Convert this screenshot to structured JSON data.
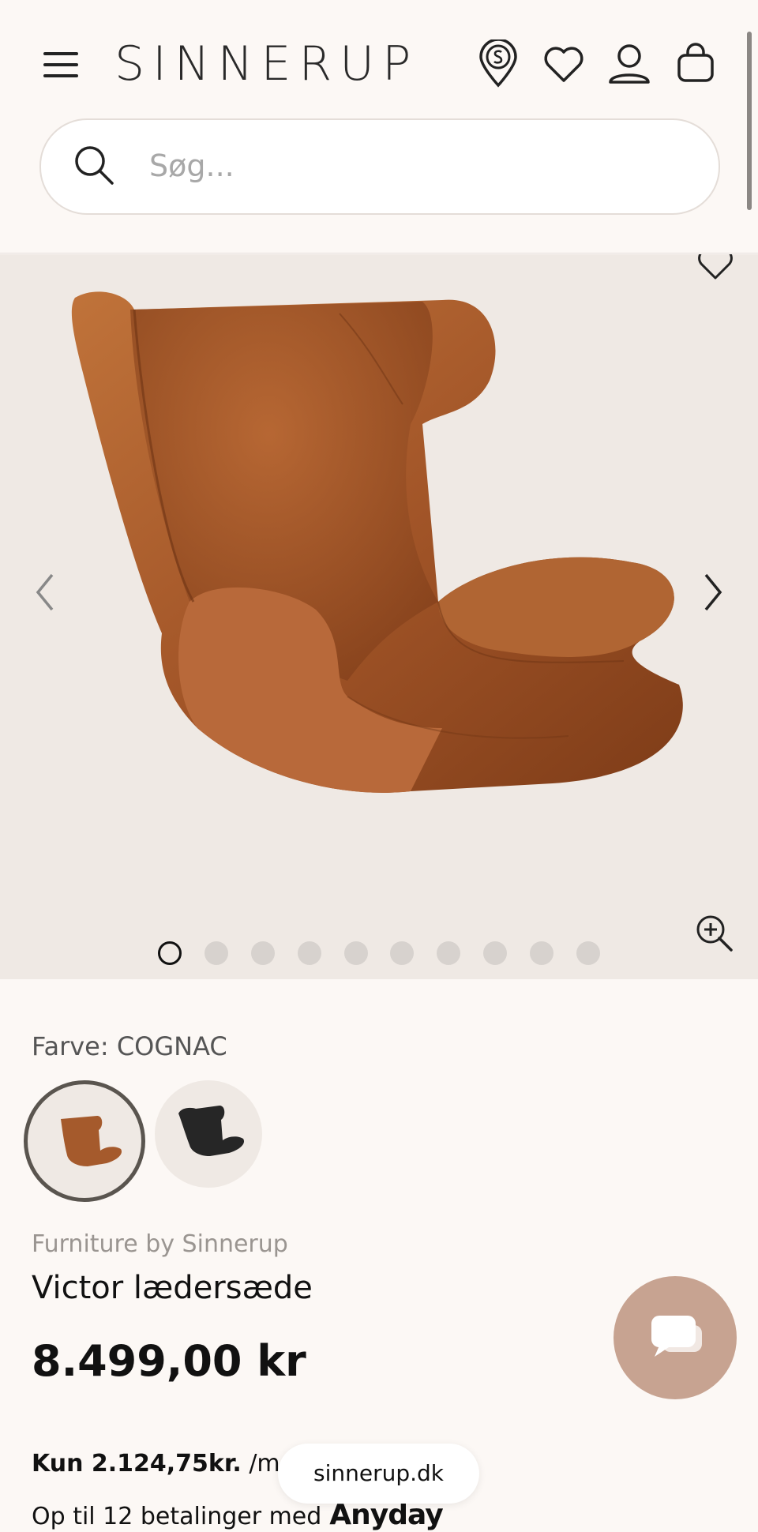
{
  "header": {
    "logo": "SINNERUP",
    "icons": [
      "menu-icon",
      "store-locator-icon",
      "wishlist-icon",
      "account-icon",
      "cart-icon"
    ]
  },
  "search": {
    "placeholder": "Søg..."
  },
  "gallery": {
    "slide_count": 10,
    "active_index": 0
  },
  "product": {
    "color_label": "Farve: COGNAC",
    "swatches": [
      "cognac",
      "black"
    ],
    "brand": "Furniture by Sinnerup",
    "title": "Victor lædersæde",
    "price": "8.499,00 kr",
    "installment_amount": "Kun 2.124,75kr.",
    "installment_suffix": " /md m",
    "installment_note": "Op til 12 betalinger med",
    "anyday": "Anyday"
  },
  "url_pill": "sinnerup.dk",
  "colors": {
    "background": "#fcf8f5",
    "gallery_bg": "#efe9e4",
    "leather": "#a55a2c",
    "chat_button": "#c7a391"
  }
}
